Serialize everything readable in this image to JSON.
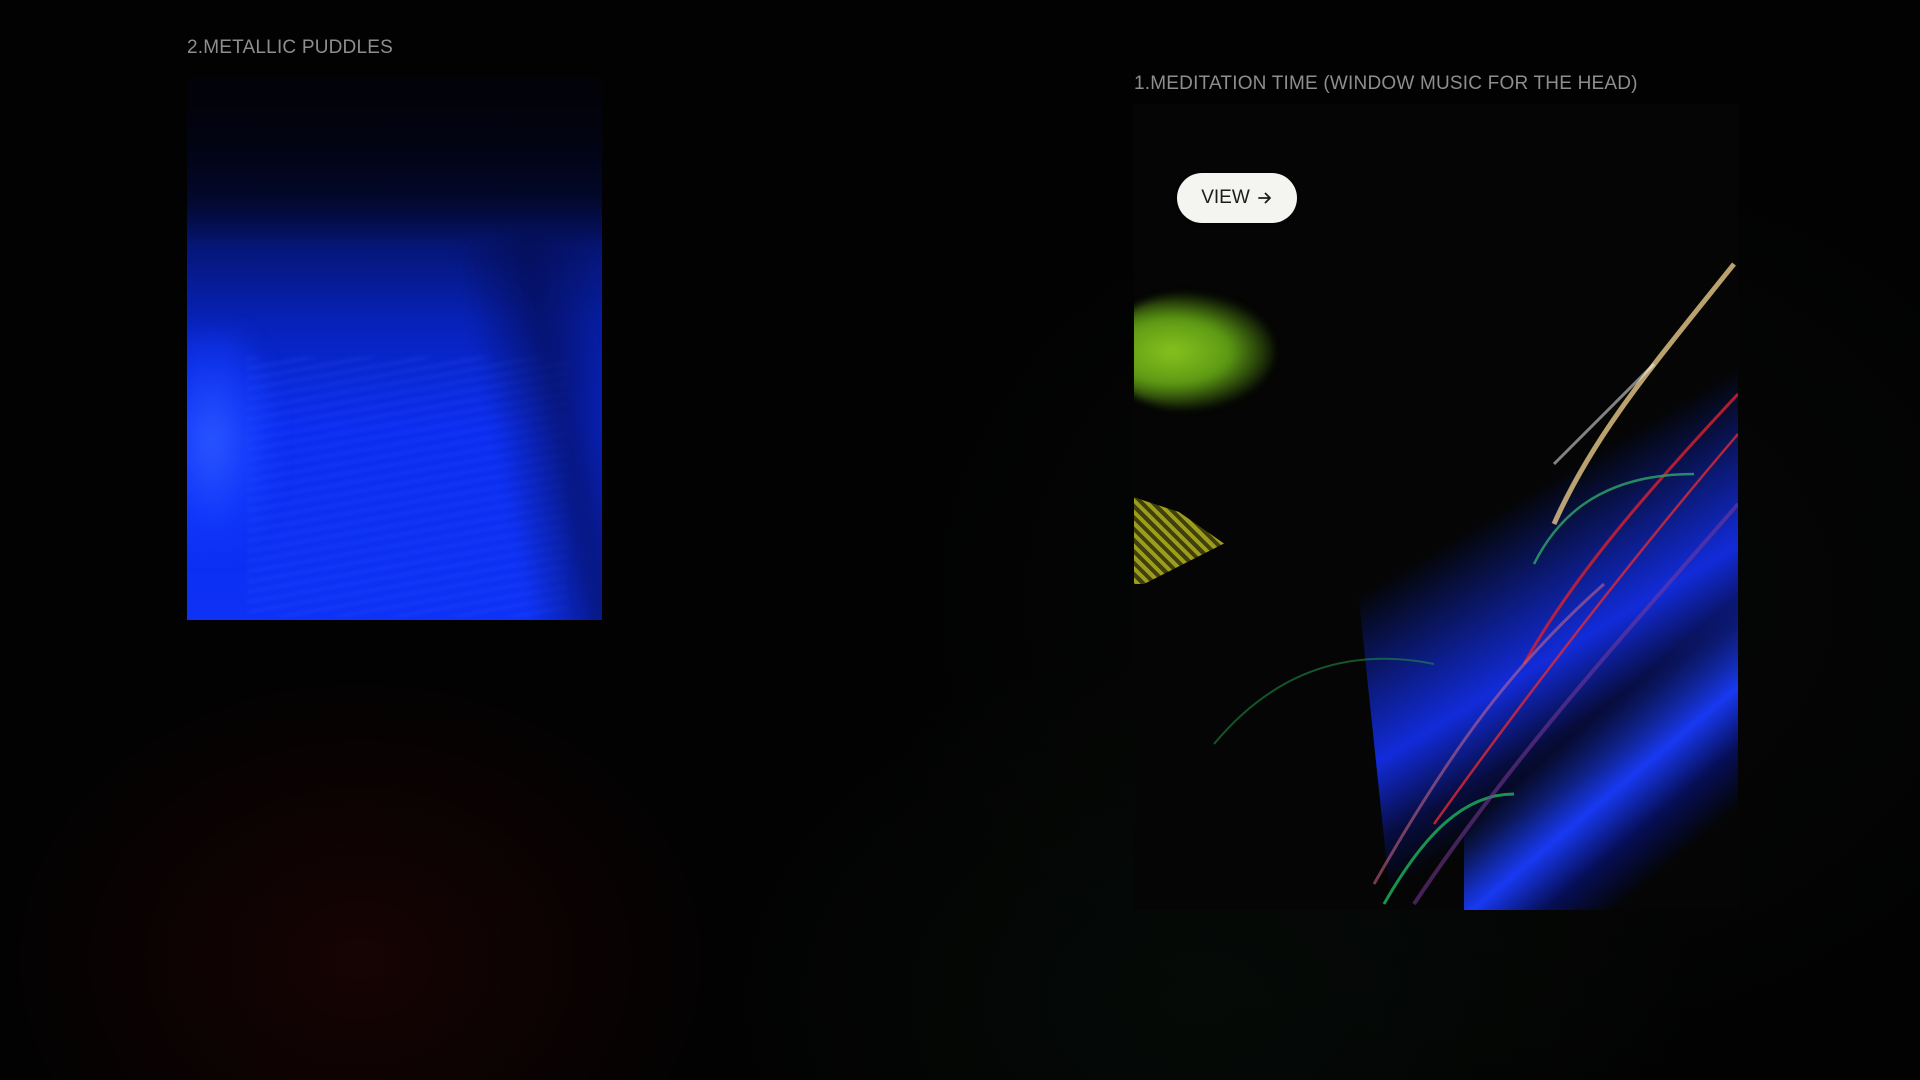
{
  "projects": [
    {
      "title": "2.METALLIC PUDDLES",
      "image": "blue-abstract-photo"
    },
    {
      "title": "1.MEDITATION TIME (WINDOW MUSIC FOR THE HEAD)",
      "image": "light-trails-abstract-photo",
      "view_label": "VIEW",
      "view_icon": "arrow-right-icon"
    }
  ],
  "colors": {
    "background": "#020202",
    "title_text": "#8e8e8e",
    "button_bg": "#f4f4f0",
    "button_text": "#1c1c1c",
    "accent_blue": "#0d31f5",
    "accent_green": "#86c21e"
  }
}
